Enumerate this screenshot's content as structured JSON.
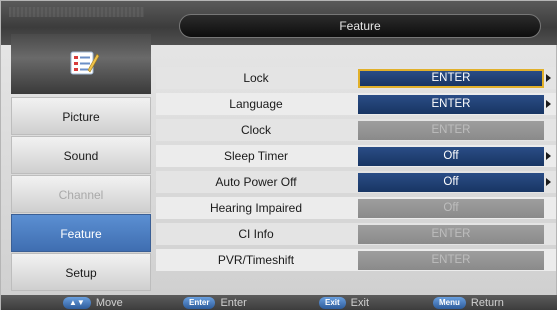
{
  "header": {
    "title": "Feature"
  },
  "icon": {
    "name": "checklist-pencil-icon"
  },
  "sidebar": {
    "items": [
      {
        "label": "Picture",
        "state": "normal"
      },
      {
        "label": "Sound",
        "state": "normal"
      },
      {
        "label": "Channel",
        "state": "disabled"
      },
      {
        "label": "Feature",
        "state": "active"
      },
      {
        "label": "Setup",
        "state": "normal"
      }
    ]
  },
  "menu": {
    "rows": [
      {
        "label": "Lock",
        "value": "ENTER",
        "style": "blue",
        "selected": true,
        "has_arrow": true
      },
      {
        "label": "Language",
        "value": "ENTER",
        "style": "blue",
        "selected": false,
        "has_arrow": true
      },
      {
        "label": "Clock",
        "value": "ENTER",
        "style": "gray",
        "selected": false,
        "has_arrow": false
      },
      {
        "label": "Sleep Timer",
        "value": "Off",
        "style": "blue",
        "selected": false,
        "has_arrow": true
      },
      {
        "label": "Auto Power Off",
        "value": "Off",
        "style": "blue",
        "selected": false,
        "has_arrow": true
      },
      {
        "label": "Hearing Impaired",
        "value": "Off",
        "style": "gray",
        "selected": false,
        "has_arrow": false
      },
      {
        "label": "CI Info",
        "value": "ENTER",
        "style": "gray",
        "selected": false,
        "has_arrow": false
      },
      {
        "label": "PVR/Timeshift",
        "value": "ENTER",
        "style": "gray",
        "selected": false,
        "has_arrow": false
      }
    ]
  },
  "footer": {
    "hints": [
      {
        "key": "▲▼",
        "label": "Move"
      },
      {
        "key": "Enter",
        "label": "Enter"
      },
      {
        "key": "Exit",
        "label": "Exit"
      },
      {
        "key": "Menu",
        "label": "Return"
      }
    ]
  },
  "colors": {
    "accent": "#3f6eb1",
    "value_blue": "#183563",
    "selection": "#e1b02a"
  }
}
